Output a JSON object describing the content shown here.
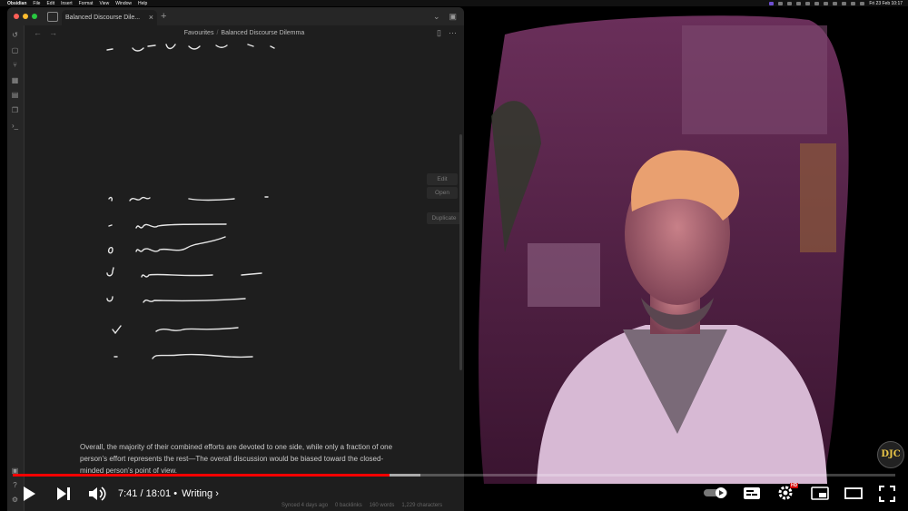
{
  "menubar": {
    "items": [
      "Obsidian",
      "File",
      "Edit",
      "Insert",
      "Format",
      "View",
      "Window",
      "Help"
    ],
    "datetime": "Fri 23 Feb 10:17"
  },
  "window": {
    "tab_title": "Balanced Discourse Dile...",
    "breadcrumb": [
      "Favourites",
      "Balanced Discourse Dilemma"
    ]
  },
  "canvas_buttons": {
    "edit": "Edit",
    "open": "Open",
    "duplicate": "Duplicate"
  },
  "note": {
    "paragraph": "Overall, the majority of their combined efforts are devoted to one side, while only a fraction of one person’s effort represents the rest—The overall discussion would be biased toward the closed-minded person’s point of view."
  },
  "status_bar": {
    "synced": "Synced 4 days ago",
    "backlinks": "0 backlinks",
    "words": "160 words",
    "characters": "1,229 characters"
  },
  "player": {
    "current_time": "7:41",
    "duration": "18:01",
    "separator": "/",
    "chapter": "Writing",
    "chapter_separator": "•",
    "progress": 0.427,
    "buffered": 0.462,
    "hd_label": "HD",
    "channel_logo": "DJC"
  },
  "colors": {
    "accent": "#ff0000",
    "obsidian_bg": "#1e1e1e",
    "video_tint": "#6a2f5a"
  }
}
